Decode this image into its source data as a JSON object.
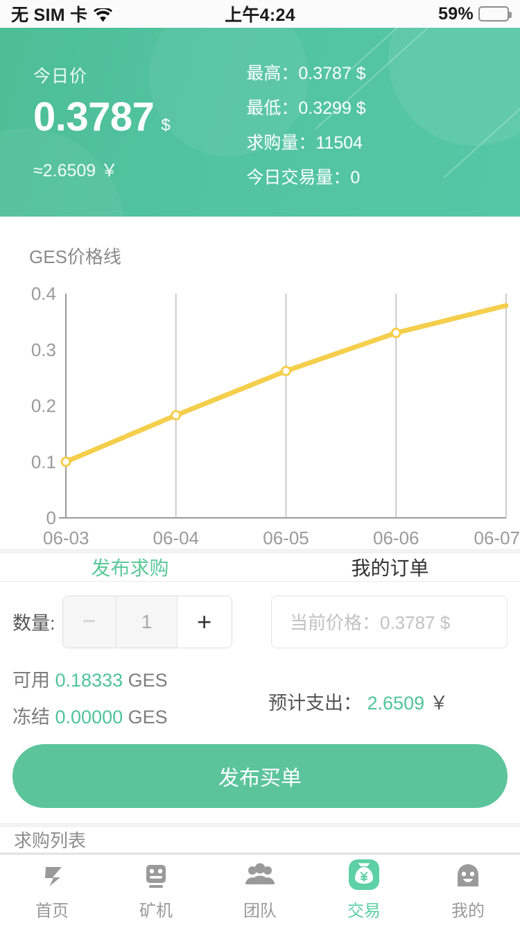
{
  "status_bar": {
    "carrier": "无 SIM 卡",
    "wifi_icon": "wifi-icon",
    "time": "上午4:24",
    "battery_percent": "59%",
    "battery_level": 59
  },
  "header": {
    "today_price_label": "今日价",
    "price": "0.3787",
    "price_unit": "$",
    "cny_approx": "≈2.6509 ￥",
    "stats": [
      {
        "label": "最高：",
        "value": "0.3787  $"
      },
      {
        "label": "最低：",
        "value": "0.3299  $"
      },
      {
        "label": "求购量：",
        "value": "11504"
      },
      {
        "label": "今日交易量：",
        "value": "0"
      }
    ],
    "bg_color": "#52c4a1"
  },
  "chart_section": {
    "title": "GES价格线"
  },
  "chart_data": {
    "type": "line",
    "title": "GES价格线",
    "x": [
      "06-03",
      "06-04",
      "06-05",
      "06-06",
      "06-07"
    ],
    "values": [
      0.1,
      0.183,
      0.262,
      0.33,
      0.3787
    ],
    "categories": [
      "06-03",
      "06-04",
      "06-05",
      "06-06",
      "06-07"
    ],
    "series": [
      {
        "name": "GES",
        "values": [
          0.1,
          0.183,
          0.262,
          0.33,
          0.3787
        ]
      }
    ],
    "ytick_labels": [
      "0",
      "0.1",
      "0.2",
      "0.3",
      "0.4"
    ],
    "yticks": [
      0,
      0.1,
      0.2,
      0.3,
      0.4
    ],
    "ylim": [
      0,
      0.4
    ],
    "xlabel": "",
    "ylabel": "",
    "grid": "vertical",
    "legend": "none",
    "line_color": "#f5ce4c",
    "marker_fill": "#ffffff",
    "axis_color": "#9a9a9a"
  },
  "tabs": [
    {
      "label": "发布求购",
      "active": true
    },
    {
      "label": "我的订单",
      "active": false
    }
  ],
  "trade_form": {
    "qty_label": "数量:",
    "minus_label": "−",
    "qty_value": "1",
    "plus_label": "+",
    "price_placeholder": "当前价格：0.3787 $",
    "price_value": "",
    "available_label": "可用",
    "available_value": "0.18333",
    "available_unit": "GES",
    "frozen_label": "冻结",
    "frozen_value": "0.00000",
    "frozen_unit": "GES",
    "estimate_label": "预计支出：",
    "estimate_value": "2.6509",
    "estimate_unit": "￥",
    "submit_label": "发布买单",
    "accent_color": "#5cc49b"
  },
  "order_list": {
    "section_title": "求购列表"
  },
  "bottom_nav": [
    {
      "label": "首页",
      "icon": "z-logo-icon",
      "active": false
    },
    {
      "label": "矿机",
      "icon": "robot-miner-icon",
      "active": false
    },
    {
      "label": "团队",
      "icon": "people-group-icon",
      "active": false
    },
    {
      "label": "交易",
      "icon": "money-bag-icon",
      "active": true
    },
    {
      "label": "我的",
      "icon": "smiley-person-icon",
      "active": false
    }
  ]
}
